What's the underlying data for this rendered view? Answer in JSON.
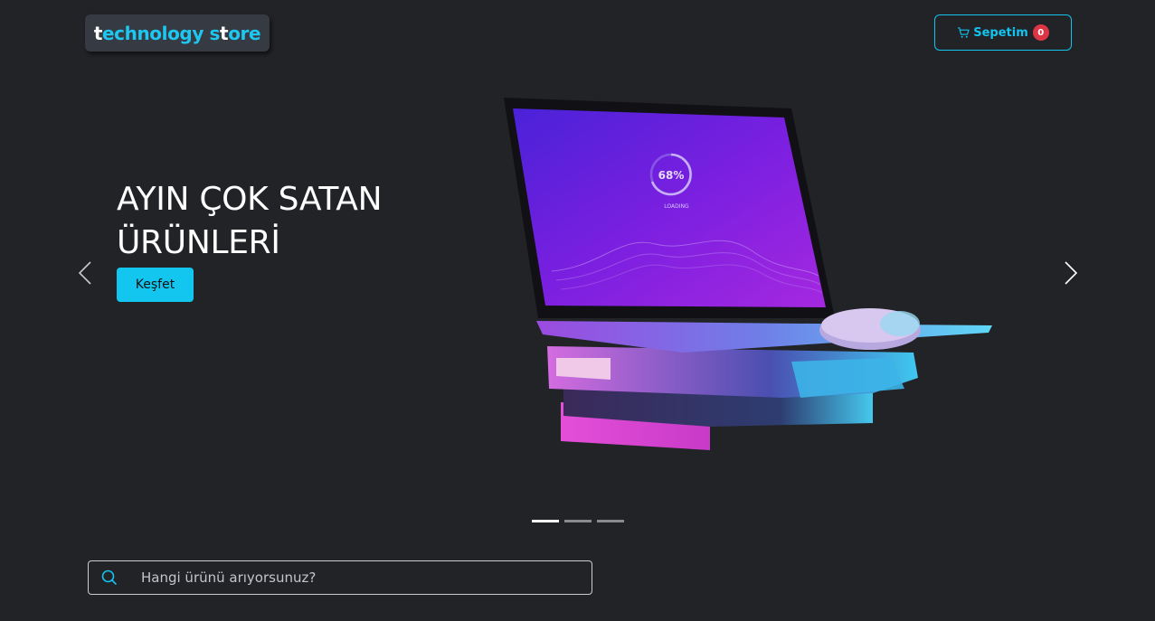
{
  "header": {
    "logo": {
      "first_letter": "t",
      "text1": "echnology s",
      "highlight": "t",
      "text2": "ore"
    },
    "cart": {
      "label": "Sepetim",
      "count": "0",
      "icon": "cart-icon"
    }
  },
  "hero": {
    "title": "AYIN ÇOK SATAN ÜRÜNLERİ",
    "button_label": "Keşfet",
    "screen_percent": "68%",
    "screen_status": "LOADING",
    "slide_count": 3,
    "active_slide": 1
  },
  "search": {
    "placeholder": "Hangi ürünü arıyorsunuz?",
    "value": "",
    "icon": "search-icon"
  },
  "colors": {
    "accent": "#14c3ee",
    "background": "#212327",
    "badge": "#dc3545"
  }
}
